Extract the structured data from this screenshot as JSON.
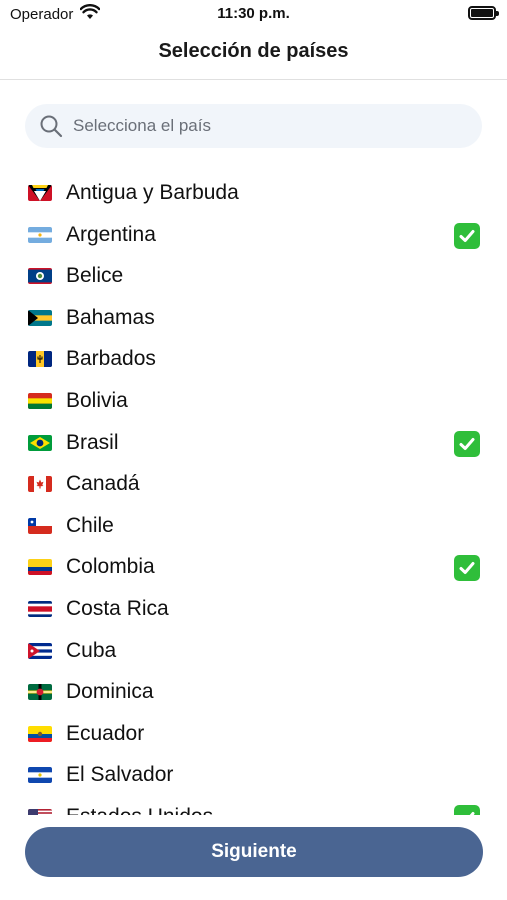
{
  "status_bar": {
    "carrier": "Operador",
    "time": "11:30 p.m.",
    "wifi_icon": "wifi-icon",
    "battery_icon": "battery-icon"
  },
  "nav": {
    "title": "Selección de países"
  },
  "search": {
    "placeholder": "Selecciona el país",
    "value": "",
    "icon": "search-icon"
  },
  "countries": [
    {
      "name": "Antigua y Barbuda",
      "flag": "flag-ag",
      "selected": false
    },
    {
      "name": "Argentina",
      "flag": "flag-ar",
      "selected": true
    },
    {
      "name": "Belice",
      "flag": "flag-bz",
      "selected": false
    },
    {
      "name": "Bahamas",
      "flag": "flag-bs",
      "selected": false
    },
    {
      "name": "Barbados",
      "flag": "flag-bb",
      "selected": false
    },
    {
      "name": "Bolivia",
      "flag": "flag-bo",
      "selected": false
    },
    {
      "name": "Brasil",
      "flag": "flag-br",
      "selected": true
    },
    {
      "name": "Canadá",
      "flag": "flag-ca",
      "selected": false
    },
    {
      "name": "Chile",
      "flag": "flag-cl",
      "selected": false
    },
    {
      "name": "Colombia",
      "flag": "flag-co",
      "selected": true
    },
    {
      "name": "Costa Rica",
      "flag": "flag-cr",
      "selected": false
    },
    {
      "name": "Cuba",
      "flag": "flag-cu",
      "selected": false
    },
    {
      "name": "Dominica",
      "flag": "flag-dm",
      "selected": false
    },
    {
      "name": "Ecuador",
      "flag": "flag-ec",
      "selected": false
    },
    {
      "name": "El Salvador",
      "flag": "flag-sv",
      "selected": false
    },
    {
      "name": "Estados Unidos",
      "flag": "flag-us",
      "selected": true
    }
  ],
  "check_icon": "checkmark-icon",
  "footer": {
    "next_label": "Siguiente"
  },
  "colors": {
    "accent_button": "#4a6592",
    "check_green": "#2fbe3a",
    "search_bg": "#f1f5fa"
  }
}
